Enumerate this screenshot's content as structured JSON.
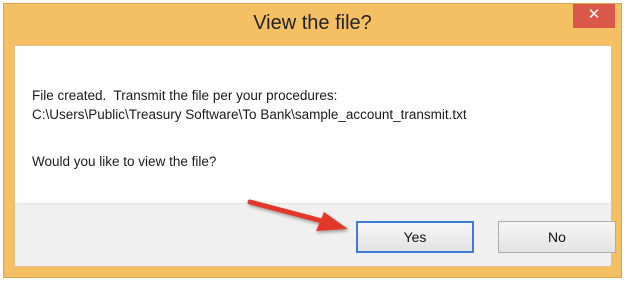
{
  "dialog": {
    "title": "View the file?",
    "close_glyph": "✕",
    "message_line1": "File created.  Transmit the file per your procedures:",
    "message_line2": "C:\\Users\\Public\\Treasury Software\\To Bank\\sample_account_transmit.txt",
    "question": "Would you like to view the file?",
    "yes_label": "Yes",
    "no_label": "No"
  },
  "colors": {
    "frame": "#f5c063",
    "close_button": "#d9584a",
    "default_button_border": "#3d7bd6",
    "annotation_arrow": "#e2382c"
  },
  "icons": {
    "annotation": "red-arrow-icon"
  }
}
